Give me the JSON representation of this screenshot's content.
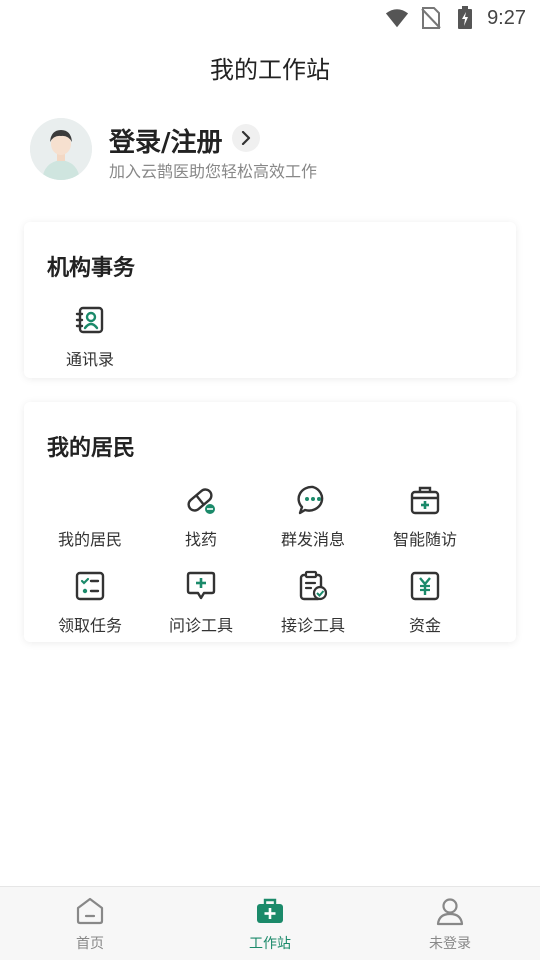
{
  "status_bar": {
    "time": "9:27"
  },
  "header": {
    "title": "我的工作站"
  },
  "profile": {
    "title": "登录/注册",
    "subtitle": "加入云鹊医助您轻松高效工作"
  },
  "institution_card": {
    "title": "机构事务",
    "items": [
      {
        "label": "通讯录",
        "icon": "contacts-icon"
      }
    ]
  },
  "residents_card": {
    "title": "我的居民",
    "items": [
      {
        "label": "我的居民",
        "icon": "residents-icon"
      },
      {
        "label": "找药",
        "icon": "pill-icon"
      },
      {
        "label": "群发消息",
        "icon": "chat-bubble-icon"
      },
      {
        "label": "智能随访",
        "icon": "medical-kit-icon"
      },
      {
        "label": "领取任务",
        "icon": "checklist-icon"
      },
      {
        "label": "问诊工具",
        "icon": "message-plus-icon"
      },
      {
        "label": "接诊工具",
        "icon": "clipboard-check-icon"
      },
      {
        "label": "资金",
        "icon": "yuan-icon"
      }
    ]
  },
  "bottom_nav": {
    "items": [
      {
        "label": "首页",
        "icon": "home-icon"
      },
      {
        "label": "工作站",
        "icon": "workstation-icon",
        "active": true
      },
      {
        "label": "未登录",
        "icon": "user-icon"
      }
    ]
  },
  "colors": {
    "accent": "#1b8a6a",
    "icon_dark": "#333333"
  }
}
